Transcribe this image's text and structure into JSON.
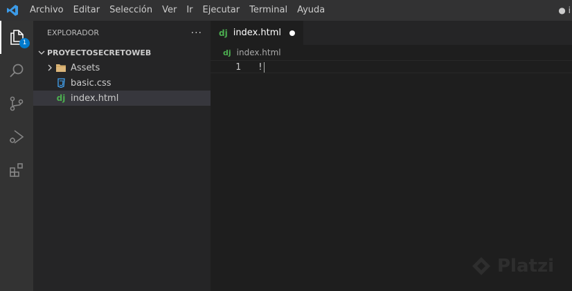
{
  "menu": [
    "Archivo",
    "Editar",
    "Selección",
    "Ver",
    "Ir",
    "Ejecutar",
    "Terminal",
    "Ayuda"
  ],
  "title_right": "● i",
  "activity": {
    "explorer_badge": "1",
    "icons": [
      "explorer-icon",
      "search-icon",
      "source-control-icon",
      "run-debug-icon",
      "extensions-icon"
    ]
  },
  "sidebar": {
    "title": "EXPLORADOR",
    "more": "···",
    "folder": "PROYECTOSECRETOWEB",
    "items": [
      {
        "label": "Assets",
        "type": "folder"
      },
      {
        "label": "basic.css",
        "type": "css"
      },
      {
        "label": "index.html",
        "type": "django",
        "selected": true
      }
    ]
  },
  "editor": {
    "tab_label": "index.html",
    "tab_icon": "dj",
    "breadcrumb": "index.html",
    "line_number": "1",
    "line_text": "!"
  },
  "watermark": "Platzi",
  "colors": {
    "accent": "#007acc",
    "django": "#4caf50",
    "css": "#42a5f5",
    "folder": "#dcb67a"
  }
}
